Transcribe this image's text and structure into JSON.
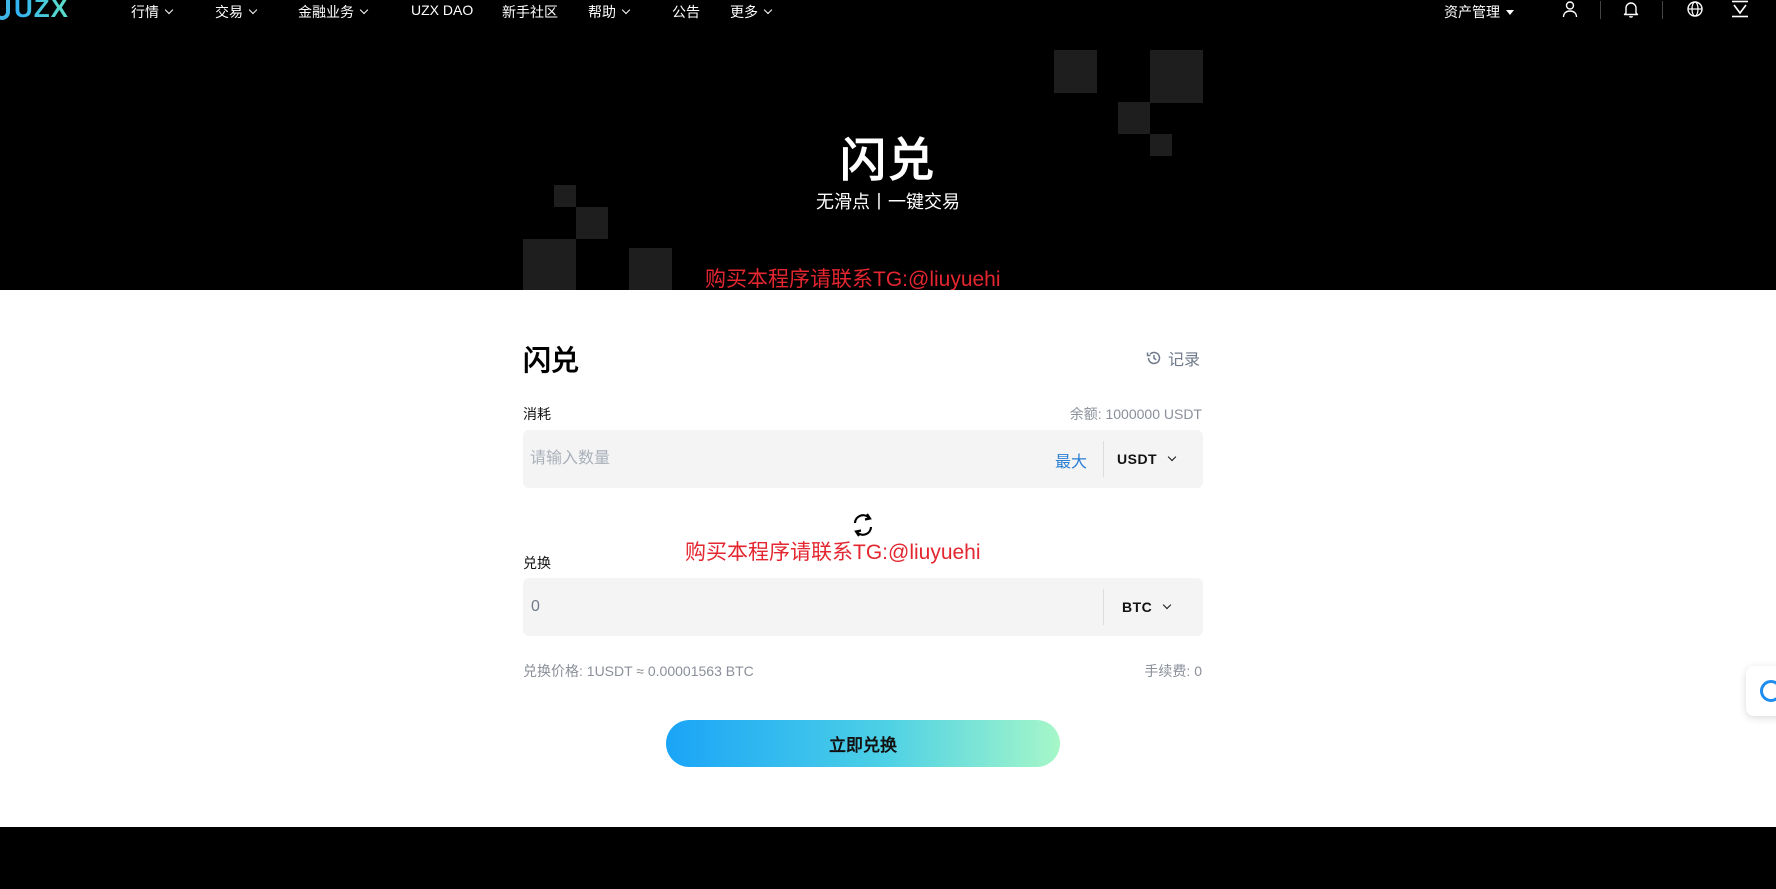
{
  "nav": {
    "logo_text": "UZX",
    "items": [
      {
        "label": "行情",
        "dropdown": true
      },
      {
        "label": "交易",
        "dropdown": true
      },
      {
        "label": "金融业务",
        "dropdown": true
      },
      {
        "label": "UZX DAO",
        "dropdown": false
      },
      {
        "label": "新手社区",
        "dropdown": false
      },
      {
        "label": "帮助",
        "dropdown": true
      },
      {
        "label": "公告",
        "dropdown": false
      },
      {
        "label": "更多",
        "dropdown": true
      }
    ],
    "assets_label": "资产管理",
    "icons": [
      "user-icon",
      "bell-icon",
      "globe-icon",
      "download-icon"
    ]
  },
  "hero": {
    "title": "闪兑",
    "subtitle": "无滑点丨一键交易"
  },
  "watermarks": {
    "top": "购买本程序请联系TG:@liuyuehi",
    "middle": "购买本程序请联系TG:@liuyuehi"
  },
  "swap": {
    "title": "闪兑",
    "records_label": "记录",
    "from": {
      "label": "消耗",
      "balance_text": "余额:  1000000 USDT",
      "placeholder": "请输入数量",
      "max_label": "最大",
      "coin": "USDT"
    },
    "to": {
      "label": "兑换",
      "value": "0",
      "coin": "BTC"
    },
    "rate_text": "兑换价格: 1USDT ≈ 0.00001563 BTC",
    "fee_text": "手续费: 0",
    "submit_label": "立即兑换"
  },
  "colors": {
    "accent_blue": "#2a7fd4",
    "watermark_red": "#e3262f",
    "button_gradient_start": "#1aa4f7",
    "button_gradient_end": "#a6f7c8"
  }
}
